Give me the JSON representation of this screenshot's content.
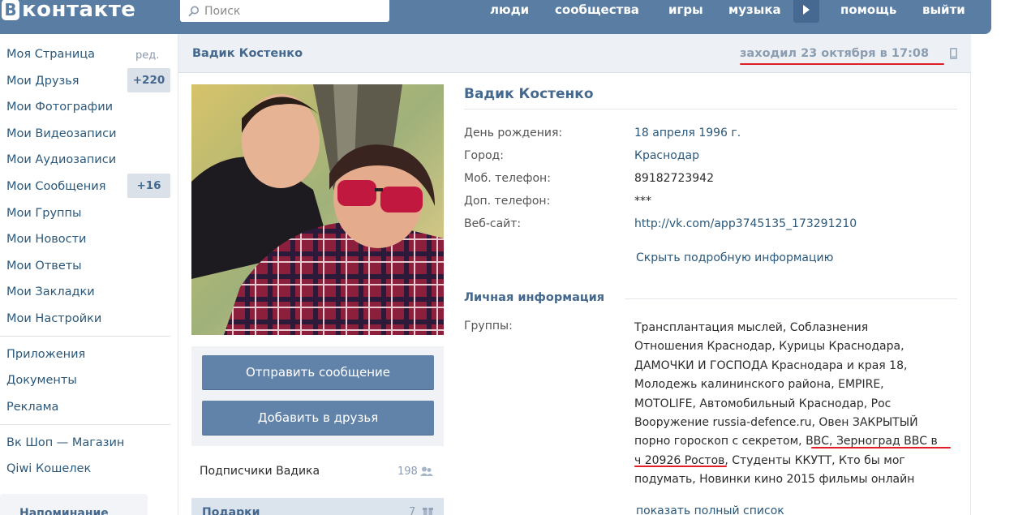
{
  "header": {
    "logo_letter": "B",
    "logo_text": "контакте",
    "search_placeholder": "Поиск",
    "nav": [
      "люди",
      "сообщества",
      "игры",
      "музыка",
      "помощь",
      "выйти"
    ]
  },
  "menu": {
    "items": [
      "Моя Страница",
      "Мои Друзья",
      "Мои Фотографии",
      "Мои Видеозаписи",
      "Мои Аудиозаписи",
      "Мои Сообщения",
      "Мои Группы",
      "Мои Новости",
      "Мои Ответы",
      "Мои Закладки",
      "Мои Настройки"
    ],
    "edit": "ред.",
    "friends_badge": "+220",
    "messages_badge": "+16",
    "extra": [
      "Приложения",
      "Документы",
      "Реклама"
    ],
    "shop": [
      "Вк Шоп — Магазин",
      "Qiwi Кошелек"
    ],
    "reminder": "Напоминание"
  },
  "page": {
    "title": "Вадик Костенко",
    "last_seen": "заходил 23 октября в 17:08"
  },
  "actions": {
    "send_message": "Отправить сообщение",
    "add_friend": "Добавить в друзья"
  },
  "subscribers": {
    "label": "Подписчики Вадика",
    "count": "198"
  },
  "gifts": {
    "label": "Подарки",
    "count": "7"
  },
  "profile": {
    "name": "Вадик Костенко",
    "fields": [
      {
        "label": "День рождения:",
        "value": "18 апреля 1996 г."
      },
      {
        "label": "Город:",
        "value": "Краснодар"
      },
      {
        "label": "Моб. телефон:",
        "value": "89182723942"
      },
      {
        "label": "Доп. телефон:",
        "value": "***"
      },
      {
        "label": "Веб-сайт:",
        "value": "http://vk.com/app3745135_173291210"
      }
    ],
    "hide_info": "Скрыть подробную информацию",
    "personal_header": "Личная информация",
    "groups_label": "Группы:",
    "groups_lines": [
      "Трансплантация мыслей, Соблазнения",
      "Отношения Краснодар, Курицы Краснодара,",
      "ДАМОЧКИ И ГОСПОДА Краснодара и края 18,",
      "Молодежь калининского района, EMPIRE,",
      "MOTOLIFE, Автомобильный Краснодар, Рос",
      "Вооружение russia-defence.ru, Овен ЗАКРЫТЫЙ",
      "порно гороскоп с секретом, ВВС, Зерноград ВВС в",
      "ч 20926 Ростов, Студенты ККУТТ, Кто бы мог",
      "подумать, Новинки кино 2015 фильмы онлайн"
    ],
    "show_all": "показать полный список"
  },
  "colors": {
    "header_bg": "#597da3",
    "link": "#2b587a",
    "title": "#45688e",
    "button": "#6183a9",
    "underline": "#e01e28"
  }
}
